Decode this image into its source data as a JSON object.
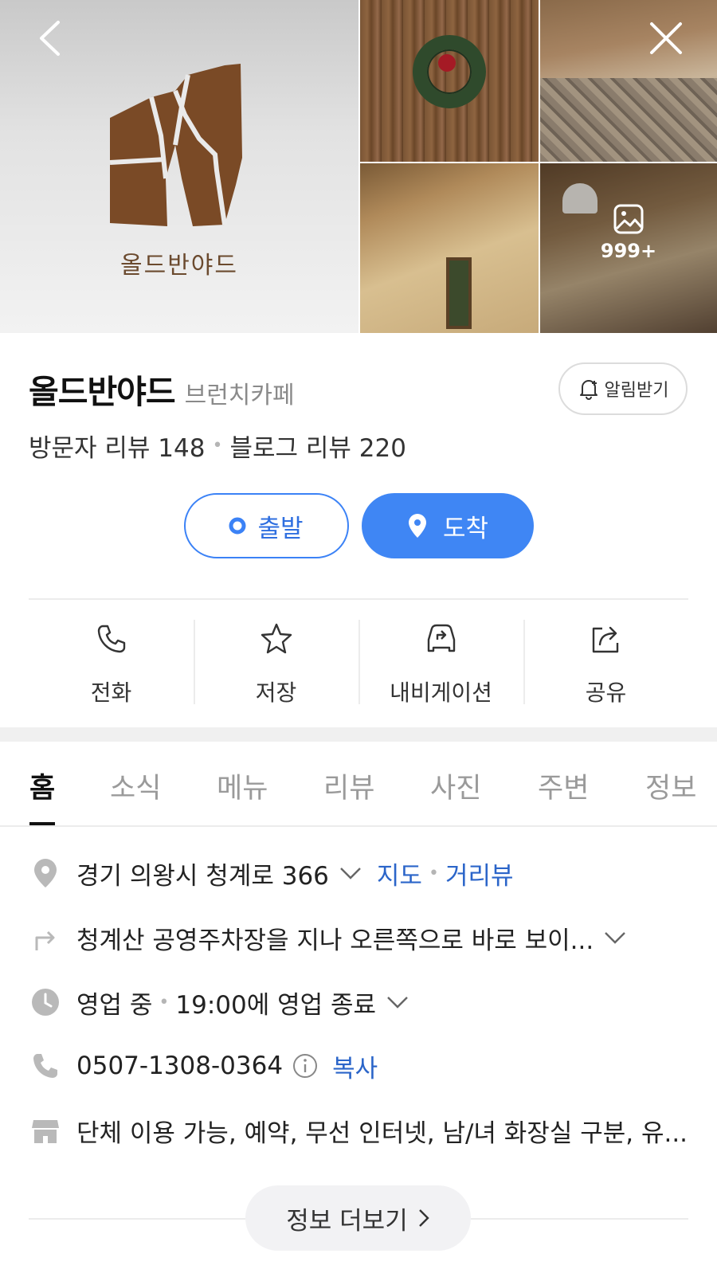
{
  "gallery": {
    "logo_text": "올드반야드",
    "photo_count": "999+"
  },
  "place": {
    "name": "올드반야드",
    "category": "브런치카페",
    "alarm_label": "알림받기",
    "visitor_reviews": "방문자 리뷰 148",
    "blog_reviews": "블로그 리뷰 220"
  },
  "route": {
    "depart_label": "출발",
    "arrive_label": "도착"
  },
  "actions": [
    {
      "label": "전화",
      "icon": "phone-icon"
    },
    {
      "label": "저장",
      "icon": "star-icon"
    },
    {
      "label": "내비게이션",
      "icon": "car-navigation-icon"
    },
    {
      "label": "공유",
      "icon": "share-icon"
    }
  ],
  "tabs": [
    "홈",
    "소식",
    "메뉴",
    "리뷰",
    "사진",
    "주변",
    "정보"
  ],
  "active_tab": "홈",
  "info": {
    "address": "경기 의왕시 청계로 366",
    "map_link": "지도",
    "roadview_link": "거리뷰",
    "directions": "청계산 공영주차장을 지나 오른쪽으로 바로 보이...",
    "status": "영업 중",
    "hours": "19:00에 영업 종료",
    "phone": "0507-1308-0364",
    "copy_label": "복사",
    "facilities": "단체 이용 가능, 예약, 무선 인터넷, 남/녀 화장실 구분, 유..."
  },
  "more_label": "정보 더보기",
  "colors": {
    "accent": "#3f86f4",
    "link": "#2b65c9",
    "logo_brown": "#7a4a26"
  }
}
